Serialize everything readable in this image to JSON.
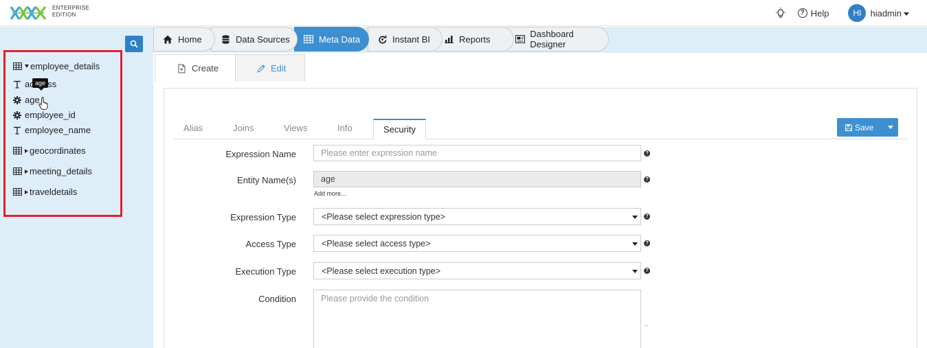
{
  "header": {
    "edition_line1": "ENTERPRISE",
    "edition_line2": "EDITION",
    "help_label": "Help",
    "user_initials": "HI",
    "username": "hiadmin"
  },
  "sidebar": {
    "tree": [
      {
        "label": "employee_details",
        "kind": "table",
        "expanded": true
      },
      {
        "label": "address",
        "kind": "text"
      },
      {
        "label": "age",
        "kind": "number"
      },
      {
        "label": "employee_id",
        "kind": "number"
      },
      {
        "label": "employee_name",
        "kind": "text"
      },
      {
        "label": "geocordinates",
        "kind": "table",
        "expanded": false
      },
      {
        "label": "meeting_details",
        "kind": "table",
        "expanded": false
      },
      {
        "label": "traveldetails",
        "kind": "table",
        "expanded": false
      }
    ],
    "tooltip": "age"
  },
  "nav": {
    "tabs": [
      {
        "label": "Home"
      },
      {
        "label": "Data Sources"
      },
      {
        "label": "Meta Data",
        "active": true
      },
      {
        "label": "Instant BI"
      },
      {
        "label": "Reports"
      },
      {
        "label": "Dashboard Designer"
      }
    ]
  },
  "subtabs": {
    "create": "Create",
    "edit": "Edit"
  },
  "inner_tabs": [
    "Alias",
    "Joins",
    "Views",
    "Info",
    "Security"
  ],
  "active_inner_tab": "Security",
  "save_label": "Save",
  "form": {
    "expression_name": {
      "label": "Expression Name",
      "placeholder": "Please enter expression name"
    },
    "entity_names": {
      "label": "Entity Name(s)",
      "value": "age",
      "add_more": "Add more..."
    },
    "expression_type": {
      "label": "Expression Type",
      "value": "<Please select expression type>"
    },
    "access_type": {
      "label": "Access Type",
      "value": "<Please select access type>"
    },
    "execution_type": {
      "label": "Execution Type",
      "value": "<Please select execution type>"
    },
    "condition": {
      "label": "Condition",
      "placeholder": "Please provide the condition"
    },
    "help_glyph": "?",
    "resize_glyph": ".."
  },
  "colors": {
    "accent": "#3d8fd0",
    "sidebar_bg": "#deeef9",
    "highlight_border": "#e32028"
  }
}
